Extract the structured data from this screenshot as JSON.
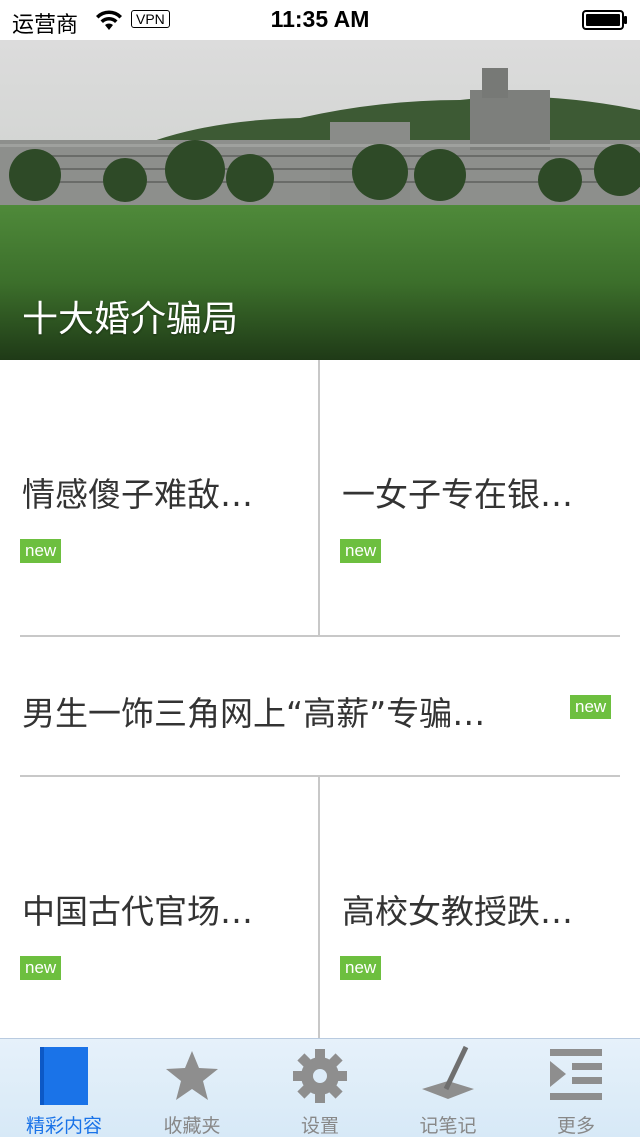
{
  "status_bar": {
    "carrier": "运营商",
    "vpn": "VPN",
    "time": "11:35 AM"
  },
  "hero": {
    "title": "十大婚介骗局"
  },
  "articles": [
    {
      "title": "情感傻子难敌…",
      "badge": "new"
    },
    {
      "title": "一女子专在银…",
      "badge": "new"
    },
    {
      "title": "男生一饰三角网上“高薪”专骗…",
      "badge": "new"
    },
    {
      "title": "中国古代官场…",
      "badge": "new"
    },
    {
      "title": "高校女教授跌…",
      "badge": "new"
    }
  ],
  "tabbar": {
    "items": [
      {
        "label": "精彩内容",
        "icon": "book-icon",
        "active": true
      },
      {
        "label": "收藏夹",
        "icon": "star-icon",
        "active": false
      },
      {
        "label": "设置",
        "icon": "gear-icon",
        "active": false
      },
      {
        "label": "记笔记",
        "icon": "pen-icon",
        "active": false
      },
      {
        "label": "更多",
        "icon": "more-list-icon",
        "active": false
      }
    ]
  },
  "colors": {
    "badge": "#6dbf3f",
    "active_tab": "#1a73e8",
    "divider": "#c8c8c8"
  }
}
